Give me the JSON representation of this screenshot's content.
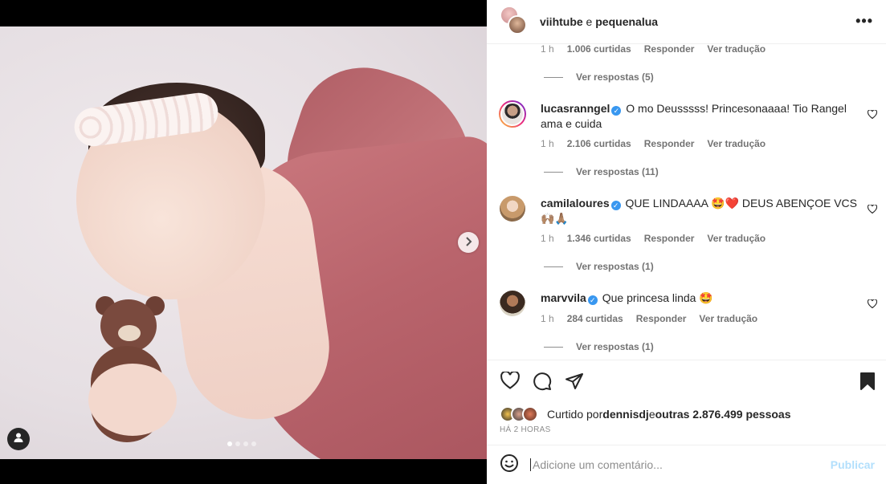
{
  "header": {
    "user1": "viihtube",
    "conjunction": " e ",
    "user2": "pequenalua",
    "more_label": "•••"
  },
  "top_meta": {
    "time": "1 h",
    "likes": "1.006 curtidas",
    "reply": "Responder",
    "translate": "Ver tradução",
    "replies": "Ver respostas (5)"
  },
  "comments": [
    {
      "user": "lucasranngel",
      "text": "O mo Deusssss! Princesonaaaa! Tio Rangel ama e cuida",
      "time": "1 h",
      "likes": "2.106 curtidas",
      "reply": "Responder",
      "translate": "Ver tradução",
      "replies": "Ver respostas (11)"
    },
    {
      "user": "camilaloures",
      "text": "QUE LINDAAAA 🤩❤️ DEUS ABENÇOE VCS 🙌🏽🙏🏽",
      "time": "1 h",
      "likes": "1.346 curtidas",
      "reply": "Responder",
      "translate": "Ver tradução",
      "replies": "Ver respostas (1)"
    },
    {
      "user": "marvvila",
      "text": "Que princesa linda 🤩",
      "time": "1 h",
      "likes": "284 curtidas",
      "reply": "Responder",
      "translate": "Ver tradução",
      "replies": "Ver respostas (1)"
    }
  ],
  "likes_line": {
    "prefix": "Curtido por ",
    "user": "dennisdj",
    "middle": " e ",
    "count": "outras 2.876.499 pessoas"
  },
  "timestamp": "HÁ 2 HORAS",
  "comment_box": {
    "placeholder": "Adicione um comentário...",
    "publish": "Publicar"
  },
  "media": {
    "carousel_total": 4,
    "carousel_active": 1
  },
  "colors": {
    "verified": "#3897f0",
    "publish_disabled": "#b2dffc",
    "muted_text": "#8e8e8e"
  },
  "icons": [
    "heart-icon",
    "comment-icon",
    "share-icon",
    "bookmark-icon",
    "emoji-icon",
    "chevron-right-icon",
    "user-tag-icon",
    "more-icon"
  ]
}
